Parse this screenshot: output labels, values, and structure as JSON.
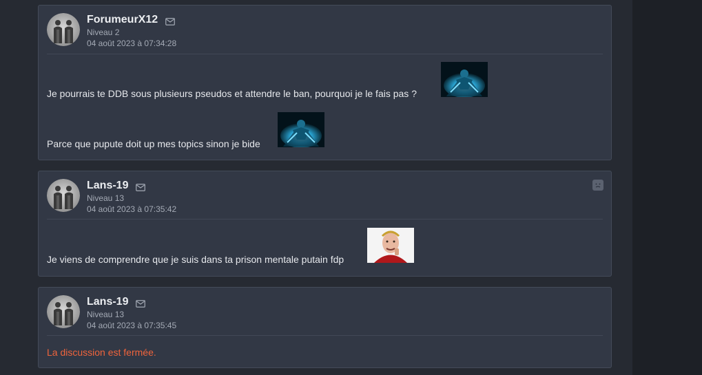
{
  "posts": [
    {
      "username": "ForumeurX12",
      "level": "Niveau 2",
      "date": "04 août 2023 à 07:34:28",
      "lines": [
        "Je pourrais te DDB sous plusieurs pseudos et attendre le ban, pourquoi je le fais pas ?",
        "Parce que pupute doit up mes topics sinon je bide"
      ]
    },
    {
      "username": "Lans-19",
      "level": "Niveau 13",
      "date": "04 août 2023 à 07:35:42",
      "lines": [
        "Je viens de comprendre que je suis dans ta prison mentale putain fdp"
      ]
    },
    {
      "username": "Lans-19",
      "level": "Niveau 13",
      "date": "04 août 2023 à 07:35:45",
      "locked_message": "La discussion est fermée."
    }
  ],
  "icons": {
    "mail": "mail-icon",
    "report": "report-icon",
    "avatar": "avatar-silhouettes",
    "sticker_blue": "blue-figure-sticker",
    "sticker_emperor": "laurel-man-sticker"
  },
  "colors": {
    "background": "#262a32",
    "post_background": "#323845",
    "locked_text": "#f0643c",
    "muted_text": "#a4aab5"
  }
}
